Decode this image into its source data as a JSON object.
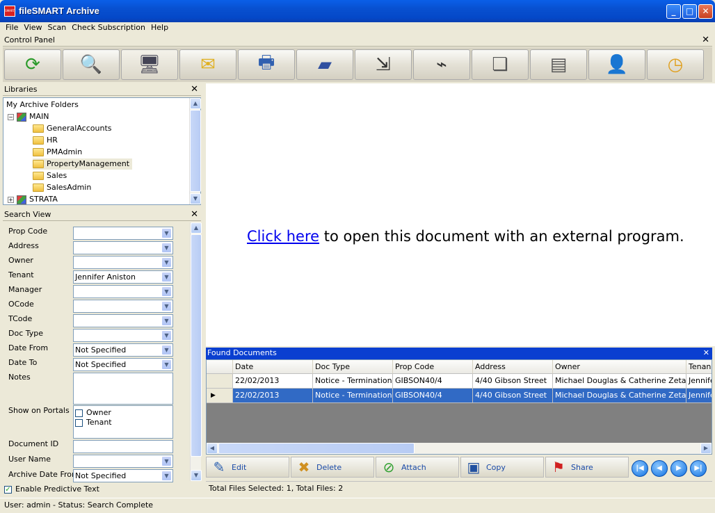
{
  "window": {
    "title": "fileSMART Archive",
    "app_icon_text": "SMART"
  },
  "menu": [
    "File",
    "View",
    "Scan",
    "Check Subscription",
    "Help"
  ],
  "control_panel": {
    "title": "Control Panel",
    "buttons": [
      "refresh-icon",
      "search-document-icon",
      "computer-icon",
      "mail-icon",
      "printer-icon",
      "scanner-icon",
      "export-icon",
      "stapler-icon",
      "copy-pages-icon",
      "compare-icon",
      "user-card-icon",
      "history-clock-icon"
    ]
  },
  "libraries": {
    "title": "Libraries",
    "root": "My Archive Folders",
    "main": "MAIN",
    "folders": [
      "GeneralAccounts",
      "HR",
      "PMAdmin",
      "PropertyManagement",
      "Sales",
      "SalesAdmin"
    ],
    "selected": "PropertyManagement",
    "strata": "STRATA"
  },
  "search_view": {
    "title": "Search View",
    "fields": [
      {
        "label": "Prop Code",
        "value": ""
      },
      {
        "label": "Address",
        "value": ""
      },
      {
        "label": "Owner",
        "value": ""
      },
      {
        "label": "Tenant",
        "value": "Jennifer Aniston"
      },
      {
        "label": "Manager",
        "value": ""
      },
      {
        "label": "OCode",
        "value": ""
      },
      {
        "label": "TCode",
        "value": ""
      },
      {
        "label": "Doc Type",
        "value": ""
      },
      {
        "label": "Date From",
        "value": "Not Specified"
      },
      {
        "label": "Date To",
        "value": "Not Specified"
      }
    ],
    "notes_label": "Notes",
    "show_on_portals_label": "Show on Portals",
    "portal_owner": "Owner",
    "portal_tenant": "Tenant",
    "document_id_label": "Document ID",
    "user_name_label": "User Name",
    "archive_date_from_label": "Archive Date From",
    "archive_date_from_value": "Not Specified",
    "predictive_text": "Enable Predictive Text"
  },
  "viewer": {
    "link": "Click here",
    "text": " to open this document with an external program."
  },
  "found": {
    "title": "Found Documents",
    "columns": [
      "Date",
      "Doc Type",
      "Prop Code",
      "Address",
      "Owner",
      "Tenan"
    ],
    "rows": [
      [
        "22/02/2013",
        "Notice - Termination",
        "GIBSON40/4",
        "4/40 Gibson Street",
        "Michael Douglas & Catherine Zeta-Jones",
        "Jennife"
      ],
      [
        "22/02/2013",
        "Notice - Termination",
        "GIBSON40/4",
        "4/40 Gibson Street",
        "Michael Douglas & Catherine Zeta-Jones",
        "Jennife"
      ]
    ],
    "actions": [
      "Edit",
      "Delete",
      "Attach",
      "Copy",
      "Share"
    ],
    "summary": "Total Files Selected: 1, Total Files: 2"
  },
  "status": "User: admin - Status: Search Complete",
  "colors": {
    "selected_row": "#316ac5",
    "title_bar": "#0a5fe8",
    "found_header": "#0a3fd0",
    "link": "#0000ee"
  }
}
